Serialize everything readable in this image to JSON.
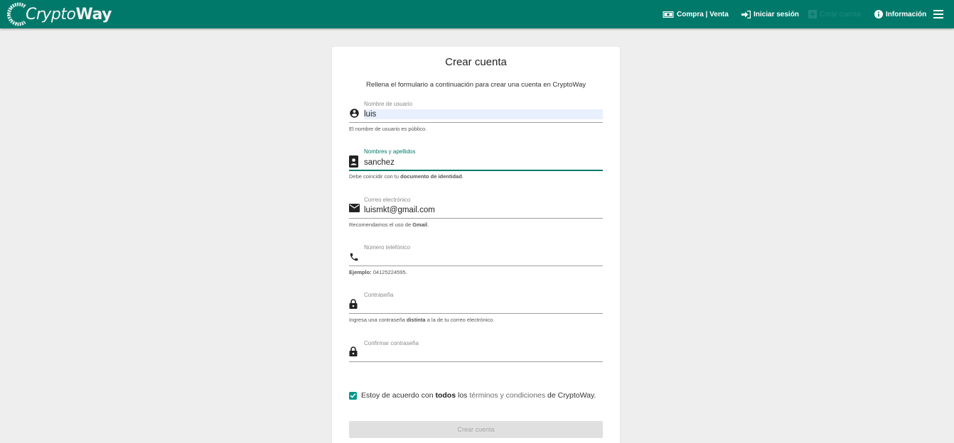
{
  "brand": {
    "name_light": "Crypto",
    "name_bold": "Way"
  },
  "nav": {
    "buy_sell": "Compra | Venta",
    "login": "Iniciar sesión",
    "register": "Crear cuenta",
    "info": "Información"
  },
  "form": {
    "title": "Crear cuenta",
    "subtitle": "Rellena el formulario a continuación para crear una cuenta en CryptoWay",
    "fields": [
      {
        "label": "Nombre de usuario",
        "value": "luis",
        "icon": "account-circle-icon"
      },
      {
        "label": "Nombres y apellidos",
        "value": "sanchez",
        "icon": "id-badge-icon"
      },
      {
        "label": "Correo electrónico",
        "value": "luismkt@gmail.com",
        "icon": "mail-icon"
      },
      {
        "label": "Número telefónico",
        "value": "",
        "icon": "phone-icon"
      },
      {
        "label": "Contraseña",
        "value": "",
        "icon": "lock-icon"
      },
      {
        "label": "Confirmar contraseña",
        "value": "",
        "icon": "lock-icon"
      }
    ],
    "hints": {
      "username": "El nombre de usuario es público.",
      "fullname_pre": "Debe coincidir con tu ",
      "fullname_bold": "documento de identidad",
      "fullname_post": ".",
      "email_pre": "Recomendamos el uso de ",
      "email_bold": "Gmail",
      "email_post": ".",
      "phone_bold": "Ejemplo:",
      "phone_post": " 04125224595.",
      "password_pre": "Ingresa una contraseña ",
      "password_bold": "distinta",
      "password_post": " a la de tu correo electrónico."
    },
    "terms": {
      "checked": true,
      "t1": "Estoy de acuerdo con ",
      "t2": "todos",
      "t3": " los ",
      "t4": "términos y condiciones",
      "t5": " de CryptoWay."
    },
    "submit_label": "Crear cuenta"
  },
  "colors": {
    "primary": "#00796b",
    "accent": "#009688",
    "background": "#eeeeee"
  }
}
